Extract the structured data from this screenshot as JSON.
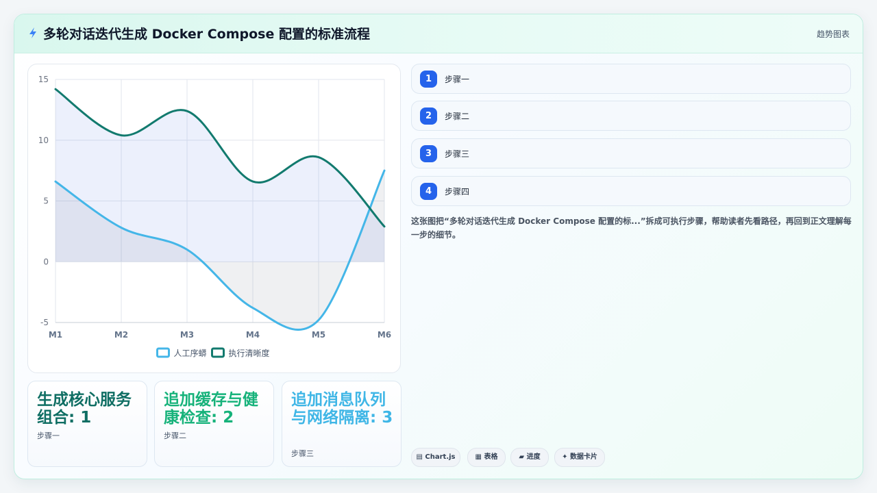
{
  "header": {
    "title": "多轮对话迭代生成 Docker Compose 配置的标准流程",
    "tag": "趋势图表",
    "icon": "lightning-icon"
  },
  "chart_data": {
    "type": "line",
    "categories": [
      "M1",
      "M2",
      "M3",
      "M4",
      "M5",
      "M6"
    ],
    "series": [
      {
        "name": "人工序蟒",
        "values": [
          6.6,
          2.8,
          1.0,
          -3.8,
          -4.8,
          7.5
        ],
        "color": "#44b6e8"
      },
      {
        "name": "执行清晰度",
        "values": [
          14.2,
          10.4,
          12.4,
          6.6,
          8.6,
          2.9
        ],
        "color": "#127a6e"
      }
    ],
    "ylim": [
      -5,
      15
    ],
    "yticks": [
      "15",
      "10",
      "5",
      "0",
      "-5"
    ],
    "area_fill": true,
    "grid": true,
    "legend": "bottom"
  },
  "steps": [
    {
      "num": "1",
      "label": "步骤一"
    },
    {
      "num": "2",
      "label": "步骤二"
    },
    {
      "num": "3",
      "label": "步骤三"
    },
    {
      "num": "4",
      "label": "步骤四"
    }
  ],
  "description": "这张图把“多轮对话迭代生成 Docker Compose 配置的标...”拆成可执行步骤，帮助读者先看路径，再回到正文理解每一步的细节。",
  "kpis": [
    {
      "value": "生成核心服务组合: 1",
      "sub": "步骤一",
      "color": "#0f6e63"
    },
    {
      "value": "追加缓存与健康检查: 2",
      "sub": "步骤二",
      "color": "#16b27a"
    },
    {
      "value": "追加消息队列与网络隔离: 3",
      "sub": "步骤三",
      "color": "#3fb6e6"
    }
  ],
  "chips": [
    {
      "icon": "▤",
      "label": "Chart.js"
    },
    {
      "icon": "▦",
      "label": "表格"
    },
    {
      "icon": "▰",
      "label": "进度"
    },
    {
      "icon": "✦",
      "label": "数据卡片"
    }
  ]
}
